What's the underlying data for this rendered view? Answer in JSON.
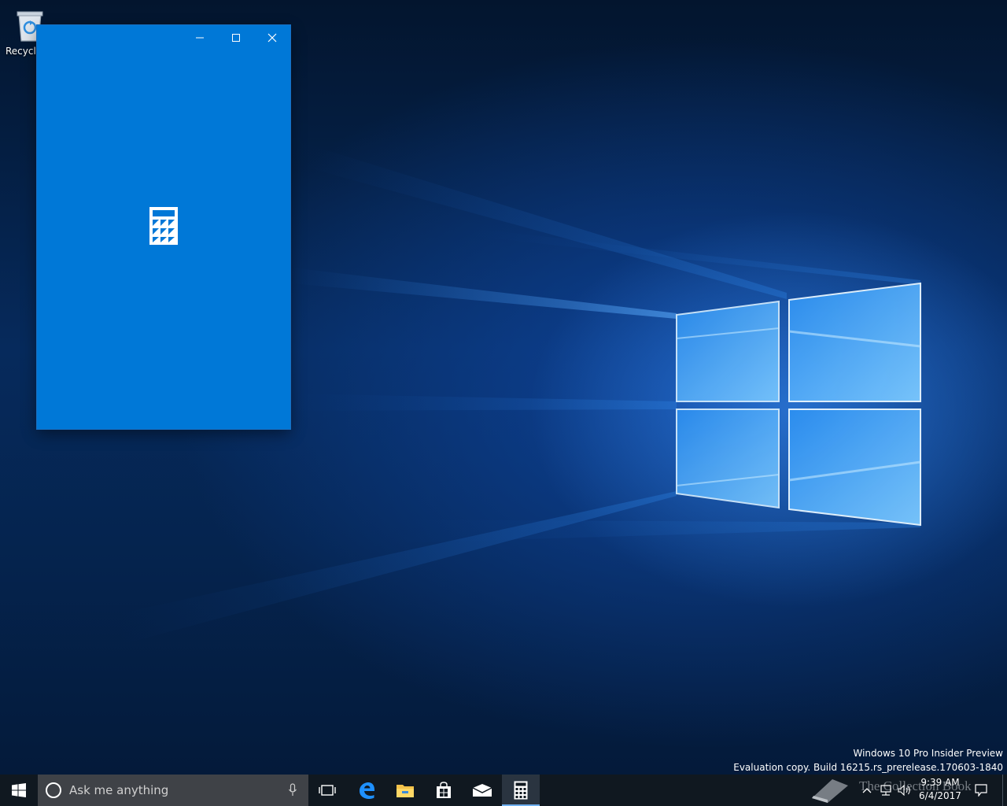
{
  "desktop": {
    "recycle_bin_label": "Recycle",
    "watermark": {
      "line1": "Windows 10 Pro Insider Preview",
      "line2": "Evaluation copy. Build 16215.rs_prerelease.170603-1840"
    }
  },
  "calculator_window": {
    "app": "Calculator",
    "state": "splash screen",
    "accent_color": "#0078d7",
    "icon": "calculator-icon",
    "caption_buttons": [
      "minimize-icon",
      "maximize-icon",
      "close-icon"
    ]
  },
  "taskbar": {
    "search": {
      "placeholder": "Ask me anything"
    },
    "pinned": [
      "task-view-icon",
      "edge-icon",
      "file-explorer-icon",
      "store-icon",
      "mail-icon",
      "calculator-icon"
    ],
    "active_app": "calculator",
    "tray": {
      "overlay_text": "The Collection Book",
      "time": "9:39 AM",
      "date": "6/4/2017"
    }
  }
}
